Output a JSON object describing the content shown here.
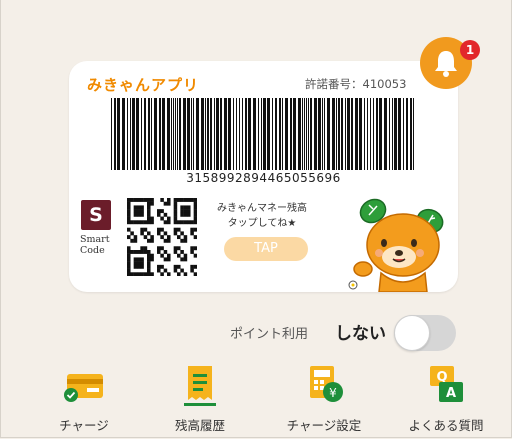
{
  "card": {
    "brand": "みきゃんアプリ",
    "license": "許諾番号：410053",
    "barcode_number": "3158992894465055696",
    "smart_code_label_line1": "Smart",
    "smart_code_label_line2": "Code",
    "prompt_line1": "みきゃんマネー残高",
    "prompt_line2": "タップしてね★",
    "tap_label": "TAP"
  },
  "notifications": {
    "count": "1"
  },
  "point_usage": {
    "label": "ポイント利用",
    "state": "しない",
    "enabled": false
  },
  "nav": [
    {
      "label": "チャージ",
      "icon": "charge-card-icon"
    },
    {
      "label": "残高履歴",
      "icon": "balance-history-icon"
    },
    {
      "label": "チャージ設定",
      "icon": "charge-settings-icon"
    },
    {
      "label": "よくある質問",
      "icon": "faq-icon"
    }
  ],
  "colors": {
    "accent": "#f08a00",
    "bell": "#f19a1e",
    "badge": "#e2272b",
    "icon_green": "#1e8f3a",
    "icon_yellow": "#f5b31c"
  }
}
